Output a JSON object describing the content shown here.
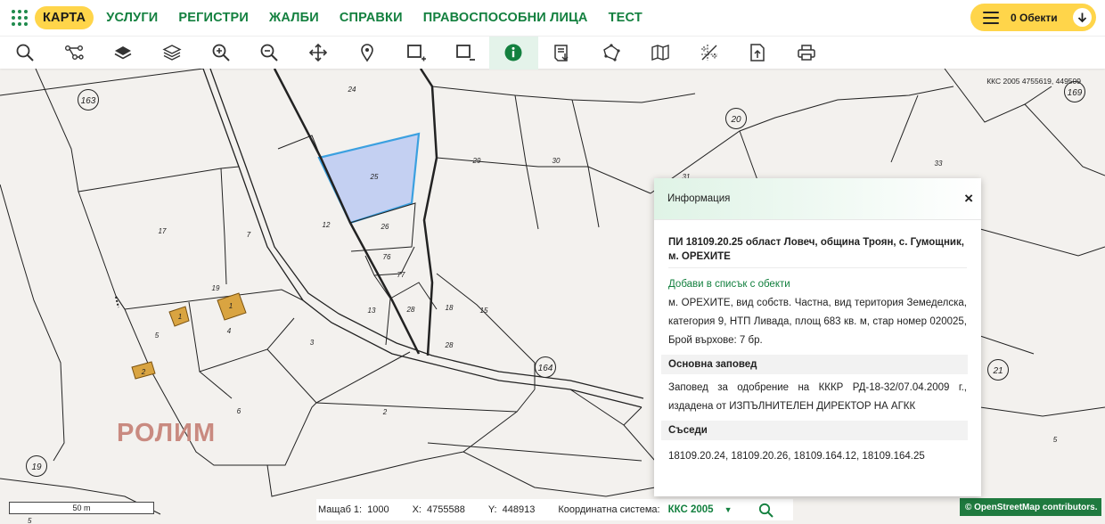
{
  "nav": {
    "items": [
      "КАРТА",
      "УСЛУГИ",
      "РЕГИСТРИ",
      "ЖАЛБИ",
      "СПРАВКИ",
      "ПРАВОСПОСОБНИ ЛИЦА",
      "ТЕСТ"
    ],
    "active_index": 0,
    "objects_label": "0 Обекти"
  },
  "toolbar": {
    "tools": [
      "search-icon",
      "route-icon",
      "layers-icon",
      "layers-outline-icon",
      "zoom-in-icon",
      "zoom-out-icon",
      "pan-icon",
      "marker-icon",
      "rect-select-add-icon",
      "rect-select-remove-icon",
      "info-icon",
      "document-icon",
      "polygon-icon",
      "map-icon",
      "measure-icon",
      "export-icon",
      "print-icon"
    ],
    "active_tool": "info-icon"
  },
  "map": {
    "coord_top": "ККС 2005 4755619, 449509",
    "watermark": "РОЛИМ",
    "scale_bar_label": "50 m",
    "scale_bar_unit": "5",
    "parcel_labels": [
      "24",
      "25",
      "26",
      "29",
      "30",
      "31",
      "33",
      "12",
      "17",
      "7",
      "76",
      "77",
      "13",
      "28",
      "18",
      "15",
      "19",
      "5",
      "4",
      "3",
      "1",
      "1",
      "2",
      "6",
      "2",
      "28",
      "5"
    ],
    "circle_labels": [
      "163",
      "20",
      "169",
      "164",
      "21",
      "19"
    ],
    "highlight_color": "#c4d0f2",
    "building_color": "#d9a441"
  },
  "status": {
    "scale_label": "Мащаб 1:",
    "scale_value": "1000",
    "x_label": "X:",
    "x_value": "4755588",
    "y_label": "Y:",
    "y_value": "448913",
    "crs_label": "Координатна система:",
    "crs_value": "ККС 2005"
  },
  "osm": "© OpenStreetMap contributors.",
  "info": {
    "header": "Информация",
    "title": "ПИ 18109.20.25 област Ловеч, община Троян, с. Гумощник, м. ОРЕХИТЕ",
    "add_link": "Добави в списък с обекти",
    "description": "м. ОРЕХИТЕ, вид собств. Частна, вид територия Земеделска, категория 9, НТП Ливада, площ 683 кв. м, стар номер 020025, Брой върхове: 7 бр.",
    "order_heading": "Основна заповед",
    "order_text": "Заповед за одобрение на КККР РД-18-32/07.04.2009 г., издадена от ИЗПЪЛНИТЕЛЕН ДИРЕКТОР НА АГКК",
    "neighbors_heading": "Съседи",
    "neighbors": "18109.20.24, 18109.20.26, 18109.164.12, 18109.164.25"
  }
}
